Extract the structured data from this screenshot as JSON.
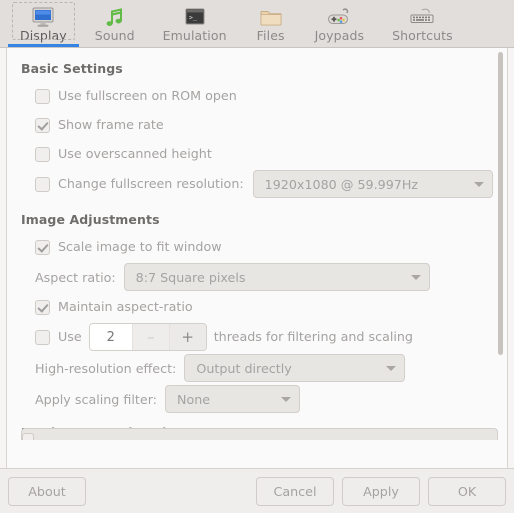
{
  "tabs": [
    {
      "id": "display",
      "label": "Display",
      "icon": "monitor-icon",
      "active": true
    },
    {
      "id": "sound",
      "label": "Sound",
      "icon": "music-note-icon",
      "active": false
    },
    {
      "id": "emulation",
      "label": "Emulation",
      "icon": "terminal-icon",
      "active": false
    },
    {
      "id": "files",
      "label": "Files",
      "icon": "folder-icon",
      "active": false
    },
    {
      "id": "joypads",
      "label": "Joypads",
      "icon": "gamepad-icon",
      "active": false
    },
    {
      "id": "shortcuts",
      "label": "Shortcuts",
      "icon": "keyboard-icon",
      "active": false
    }
  ],
  "sections": {
    "basic": {
      "title": "Basic Settings",
      "fullscreen_rom": {
        "label": "Use fullscreen on ROM open",
        "checked": false
      },
      "frame_rate": {
        "label": "Show frame rate",
        "checked": true
      },
      "overscan": {
        "label": "Use overscanned height",
        "checked": false
      },
      "change_res": {
        "label": "Change fullscreen resolution:",
        "checked": false,
        "value": "1920x1080 @ 59.997Hz"
      }
    },
    "image": {
      "title": "Image Adjustments",
      "scale_fit": {
        "label": "Scale image to fit window",
        "checked": true
      },
      "aspect_ratio": {
        "label": "Aspect ratio:",
        "value": "8:7 Square pixels"
      },
      "maintain_ar": {
        "label": "Maintain aspect-ratio",
        "checked": true
      },
      "threads": {
        "label_before": "Use",
        "label_after": "threads for filtering and scaling",
        "checked": false,
        "value": "2",
        "decrement": "–",
        "increment": "+"
      },
      "hires": {
        "label": "High-resolution effect:",
        "value": "Output directly"
      },
      "scaling": {
        "label": "Apply scaling filter:",
        "value": "None"
      }
    },
    "hardware": {
      "title": "Hardware Acceleration"
    }
  },
  "actions": {
    "about": "About",
    "cancel": "Cancel",
    "apply": "Apply",
    "ok": "OK"
  },
  "colors": {
    "accent": "#3584e4",
    "tabbar_bg": "#e1dedb",
    "content_bg": "#fbfafa"
  }
}
